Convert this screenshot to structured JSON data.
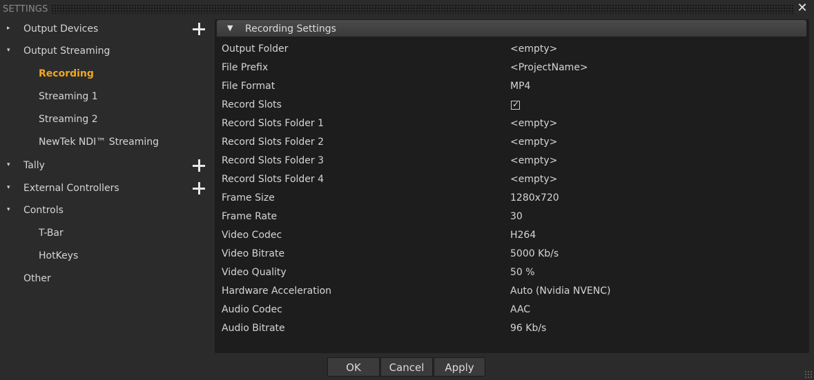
{
  "window": {
    "title": "SETTINGS",
    "close_icon": "close-icon"
  },
  "sidebar": {
    "items": [
      {
        "label": "Output Devices",
        "arrow": "▸",
        "has_add": true
      },
      {
        "label": "Output Streaming",
        "arrow": "▾",
        "has_add": false
      },
      {
        "label": "Recording",
        "active": true
      },
      {
        "label": "Streaming 1"
      },
      {
        "label": "Streaming 2"
      },
      {
        "label": "NewTek NDI™ Streaming"
      },
      {
        "label": "Tally",
        "arrow": "▾",
        "has_add": true
      },
      {
        "label": "External Controllers",
        "arrow": "▾",
        "has_add": true
      },
      {
        "label": "Controls",
        "arrow": "▾",
        "has_add": false
      },
      {
        "label": "T-Bar"
      },
      {
        "label": "HotKeys"
      },
      {
        "label": "Other"
      }
    ]
  },
  "panel": {
    "header": "Recording Settings",
    "rows": [
      {
        "name": "Output Folder",
        "value": "<empty>"
      },
      {
        "name": "File Prefix",
        "value": "<ProjectName>"
      },
      {
        "name": "File Format",
        "value": "MP4"
      },
      {
        "name": "Record Slots",
        "checked": true
      },
      {
        "name": "Record Slots Folder 1",
        "value": "<empty>"
      },
      {
        "name": "Record Slots Folder 2",
        "value": "<empty>"
      },
      {
        "name": "Record Slots Folder 3",
        "value": "<empty>"
      },
      {
        "name": "Record Slots Folder 4",
        "value": "<empty>"
      },
      {
        "name": "Frame Size",
        "value": "1280x720"
      },
      {
        "name": "Frame Rate",
        "value": "30"
      },
      {
        "name": "Video Codec",
        "value": "H264"
      },
      {
        "name": "Video Bitrate",
        "value": "5000 Kb/s"
      },
      {
        "name": "Video Quality",
        "value": "50 %"
      },
      {
        "name": "Hardware Acceleration",
        "value": "Auto (Nvidia NVENC)"
      },
      {
        "name": "Audio Codec",
        "value": "AAC"
      },
      {
        "name": "Audio Bitrate",
        "value": "96 Kb/s"
      }
    ]
  },
  "footer": {
    "ok": "OK",
    "cancel": "Cancel",
    "apply": "Apply"
  },
  "colors": {
    "accent": "#f0a81c",
    "panel_bg": "#1d1d1d",
    "window_bg": "#2b2b2b"
  }
}
